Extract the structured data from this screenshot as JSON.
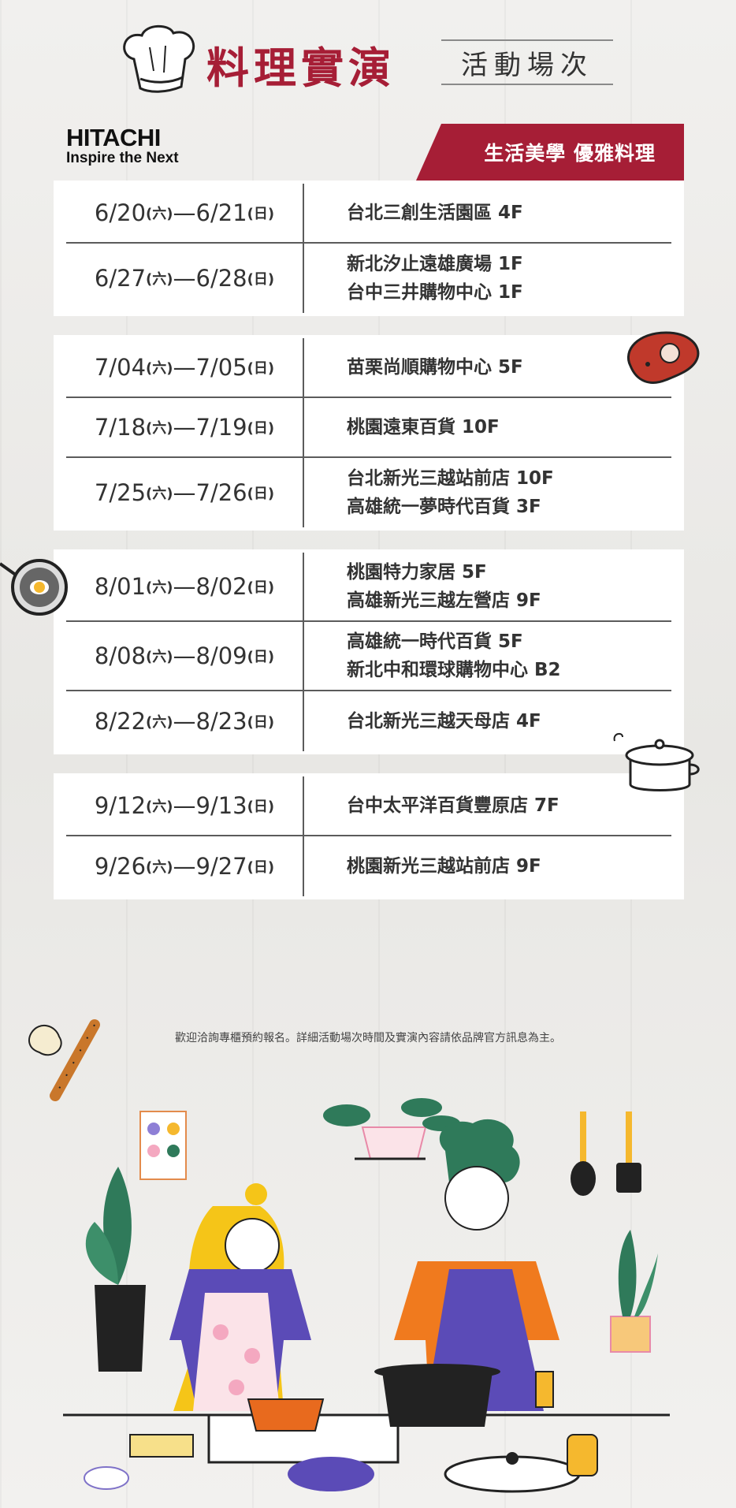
{
  "header": {
    "title": "料理實演",
    "subtitle": "活動場次"
  },
  "brand": {
    "name": "HITACHI",
    "tagline": "Inspire the Next"
  },
  "ribbon": "生活美學 優雅料理",
  "schedule": [
    [
      {
        "d1": "6/20",
        "w1": "(六)",
        "d2": "6/21",
        "w2": "(日)",
        "locations": [
          "台北三創生活園區 4F"
        ]
      },
      {
        "d1": "6/27",
        "w1": "(六)",
        "d2": "6/28",
        "w2": "(日)",
        "locations": [
          "新北汐止遠雄廣場 1F",
          "台中三井購物中心 1F"
        ]
      }
    ],
    [
      {
        "d1": "7/04",
        "w1": "(六)",
        "d2": "7/05",
        "w2": "(日)",
        "locations": [
          "苗栗尚順購物中心 5F"
        ]
      },
      {
        "d1": "7/18",
        "w1": "(六)",
        "d2": "7/19",
        "w2": "(日)",
        "locations": [
          "桃園遠東百貨 10F"
        ]
      },
      {
        "d1": "7/25",
        "w1": "(六)",
        "d2": "7/26",
        "w2": "(日)",
        "locations": [
          "台北新光三越站前店 10F",
          "高雄統一夢時代百貨 3F"
        ]
      }
    ],
    [
      {
        "d1": "8/01",
        "w1": "(六)",
        "d2": "8/02",
        "w2": "(日)",
        "locations": [
          "桃園特力家居 5F",
          "高雄新光三越左營店 9F"
        ]
      },
      {
        "d1": "8/08",
        "w1": "(六)",
        "d2": "8/09",
        "w2": "(日)",
        "locations": [
          "高雄統一時代百貨 5F",
          "新北中和環球購物中心 B2"
        ]
      },
      {
        "d1": "8/22",
        "w1": "(六)",
        "d2": "8/23",
        "w2": "(日)",
        "locations": [
          "台北新光三越天母店 4F"
        ]
      }
    ],
    [
      {
        "d1": "9/12",
        "w1": "(六)",
        "d2": "9/13",
        "w2": "(日)",
        "locations": [
          "台中太平洋百貨豐原店 7F"
        ]
      },
      {
        "d1": "9/26",
        "w1": "(六)",
        "d2": "9/27",
        "w2": "(日)",
        "locations": [
          "桃園新光三越站前店 9F"
        ]
      }
    ]
  ],
  "note": "歡迎洽詢專櫃預約報名。詳細活動場次時間及實演內容請依品牌官方訊息為主。",
  "dash": "—",
  "colors": {
    "accent": "#a61e36",
    "divider": "#5b5b5b"
  },
  "icons": [
    "chef-hat-icon",
    "steak-icon",
    "frying-pan-egg-icon",
    "pot-icon",
    "rolling-pin-icon",
    "cooking-couple-illustration"
  ]
}
